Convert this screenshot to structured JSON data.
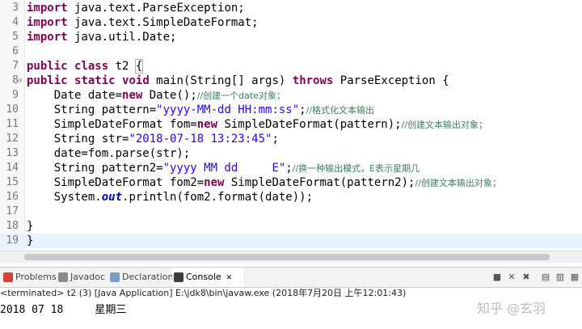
{
  "editor": {
    "lines": [
      {
        "num": "3",
        "segments": [
          [
            "kw",
            "import"
          ],
          [
            "plain",
            " java.text.ParseException;"
          ]
        ]
      },
      {
        "num": "4",
        "segments": [
          [
            "kw",
            "import"
          ],
          [
            "plain",
            " java.text.SimpleDateFormat;"
          ]
        ]
      },
      {
        "num": "5",
        "segments": [
          [
            "kw",
            "import"
          ],
          [
            "plain",
            " java.util.Date;"
          ]
        ]
      },
      {
        "num": "6",
        "segments": []
      },
      {
        "num": "7",
        "segments": [
          [
            "kw",
            "public"
          ],
          [
            "plain",
            " "
          ],
          [
            "kw",
            "class"
          ],
          [
            "plain",
            " t2 "
          ],
          [
            "brk",
            "{"
          ]
        ]
      },
      {
        "num": "8",
        "fold": "⊖",
        "segments": [
          [
            "kw",
            "public"
          ],
          [
            "plain",
            " "
          ],
          [
            "kw",
            "static"
          ],
          [
            "plain",
            " "
          ],
          [
            "kw",
            "void"
          ],
          [
            "plain",
            " main(String[] args) "
          ],
          [
            "kw",
            "throws"
          ],
          [
            "plain",
            " ParseException {"
          ]
        ]
      },
      {
        "num": "9",
        "segments": [
          [
            "plain",
            "    Date date="
          ],
          [
            "kw",
            "new"
          ],
          [
            "plain",
            " Date();"
          ],
          [
            "cm",
            "//创建一个date对象；"
          ]
        ]
      },
      {
        "num": "10",
        "segments": [
          [
            "plain",
            "    String pattern="
          ],
          [
            "str",
            "\"yyyy-MM-dd HH:mm:ss\""
          ],
          [
            "plain",
            ";"
          ],
          [
            "cm",
            "//格式化文本输出"
          ]
        ]
      },
      {
        "num": "11",
        "segments": [
          [
            "plain",
            "    SimpleDateFormat fom="
          ],
          [
            "kw",
            "new"
          ],
          [
            "plain",
            " SimpleDateFormat(pattern);"
          ],
          [
            "cm",
            "//创建文本输出对象；"
          ]
        ]
      },
      {
        "num": "12",
        "segments": [
          [
            "plain",
            "    String str="
          ],
          [
            "str",
            "\"2018-07-18 13:23:45\""
          ],
          [
            "plain",
            ";"
          ]
        ]
      },
      {
        "num": "13",
        "segments": [
          [
            "plain",
            "    date=fom.parse(str);"
          ]
        ]
      },
      {
        "num": "14",
        "segments": [
          [
            "plain",
            "    String pattern2="
          ],
          [
            "str",
            "\"yyyy MM dd     E\""
          ],
          [
            "plain",
            ";"
          ],
          [
            "cm",
            "//换一种输出模式，E表示星期几"
          ]
        ]
      },
      {
        "num": "15",
        "segments": [
          [
            "plain",
            "    SimpleDateFormat fom2="
          ],
          [
            "kw",
            "new"
          ],
          [
            "plain",
            " SimpleDateFormat(pattern2);"
          ],
          [
            "cm",
            "//创建文本输出对象；"
          ]
        ]
      },
      {
        "num": "16",
        "segments": [
          [
            "plain",
            "    System."
          ],
          [
            "fld",
            "out"
          ],
          [
            "plain",
            ".println(fom2.format(date));"
          ]
        ]
      },
      {
        "num": "17",
        "segments": []
      },
      {
        "num": "18",
        "segments": [
          [
            "plain",
            "}"
          ]
        ]
      },
      {
        "num": "19",
        "current": true,
        "segments": [
          [
            "plain",
            "}"
          ]
        ]
      }
    ]
  },
  "console_tabs": [
    {
      "label": "Problems",
      "icon": "problems-icon",
      "color": "#d04437"
    },
    {
      "label": "Javadoc",
      "icon": "javadoc-icon",
      "color": "#8a8a8a",
      "prefix": "@"
    },
    {
      "label": "Declaration",
      "icon": "declaration-icon",
      "color": "#7a9cc6"
    },
    {
      "label": "Console",
      "icon": "console-icon",
      "color": "#3c3c3c",
      "close": "✕",
      "active": true
    }
  ],
  "status_text": "<terminated> t2 (3) [Java Application] E:\\jdk8\\bin\\javaw.exe (2018年7月20日 上午12:01:43)",
  "console_output": "2018 07 18     星期三",
  "watermark": "知乎 @玄羽",
  "colors": {
    "keyword": "#7f0055",
    "string": "#2a00ff",
    "comment": "#3f7f5f",
    "field": "#0000c0"
  }
}
